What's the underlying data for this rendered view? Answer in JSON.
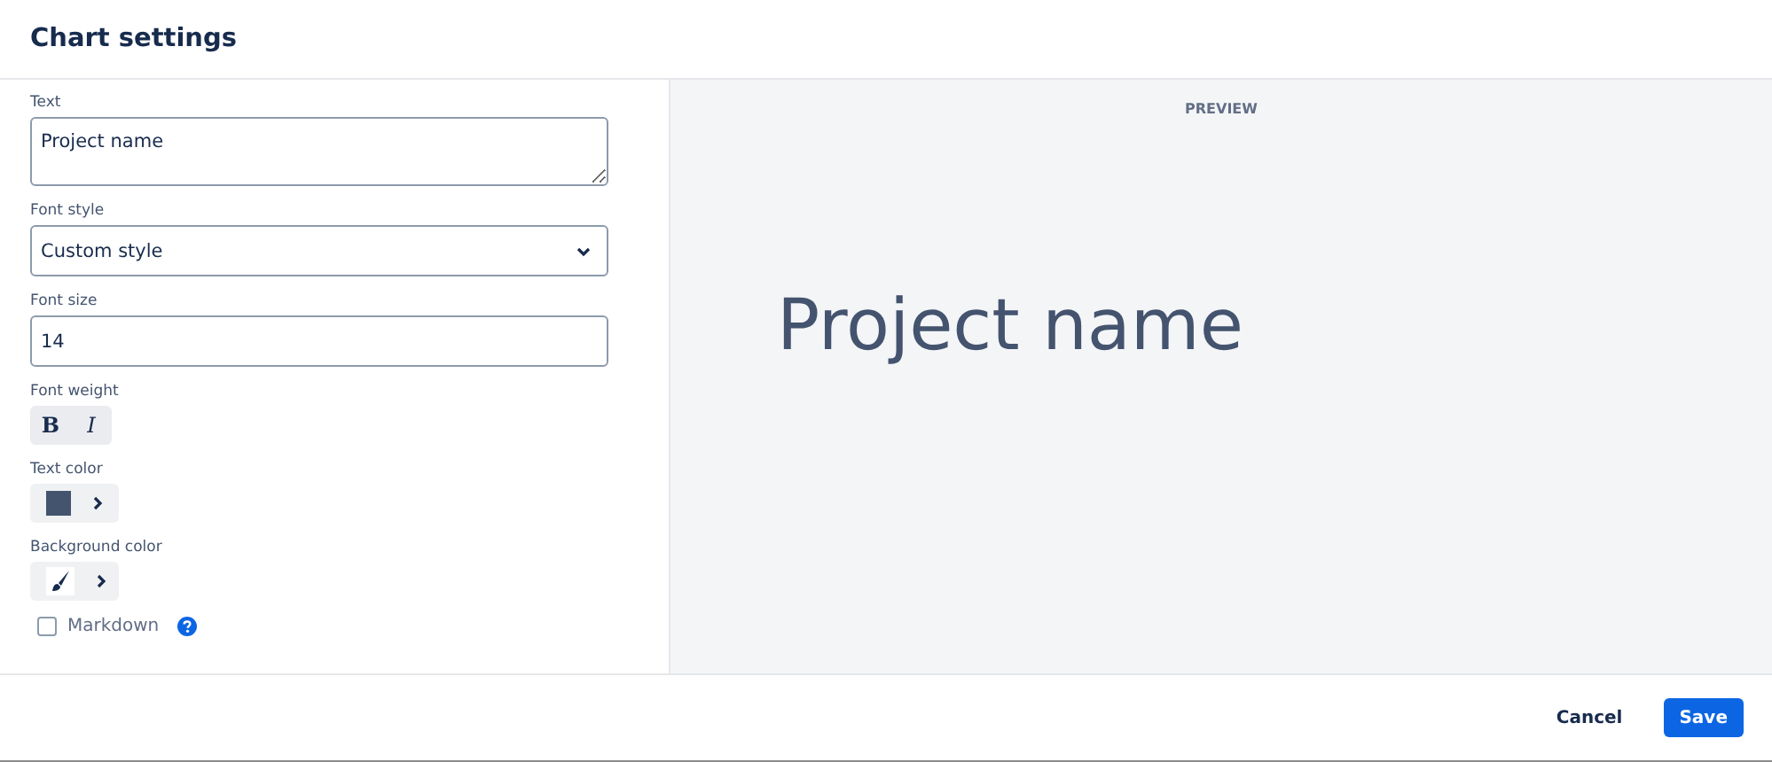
{
  "dialog": {
    "title": "Chart settings"
  },
  "form": {
    "text": {
      "label": "Text",
      "value": "Project name"
    },
    "font_style": {
      "label": "Font style",
      "value": "Custom style"
    },
    "font_size": {
      "label": "Font size",
      "value": "14"
    },
    "font_weight": {
      "label": "Font weight",
      "buttons": [
        {
          "label": "B",
          "kind": "bold"
        },
        {
          "label": "I",
          "kind": "italic"
        }
      ]
    },
    "text_color": {
      "label": "Text color",
      "color": "#44546f"
    },
    "background_color": {
      "label": "Background color"
    },
    "markdown": {
      "label": "Markdown",
      "checked": false
    }
  },
  "preview": {
    "label": "PREVIEW",
    "text": "Project name"
  },
  "buttons": [
    {
      "label": "Cancel",
      "kind": "subtle"
    },
    {
      "label": "Save",
      "kind": "primary"
    }
  ]
}
